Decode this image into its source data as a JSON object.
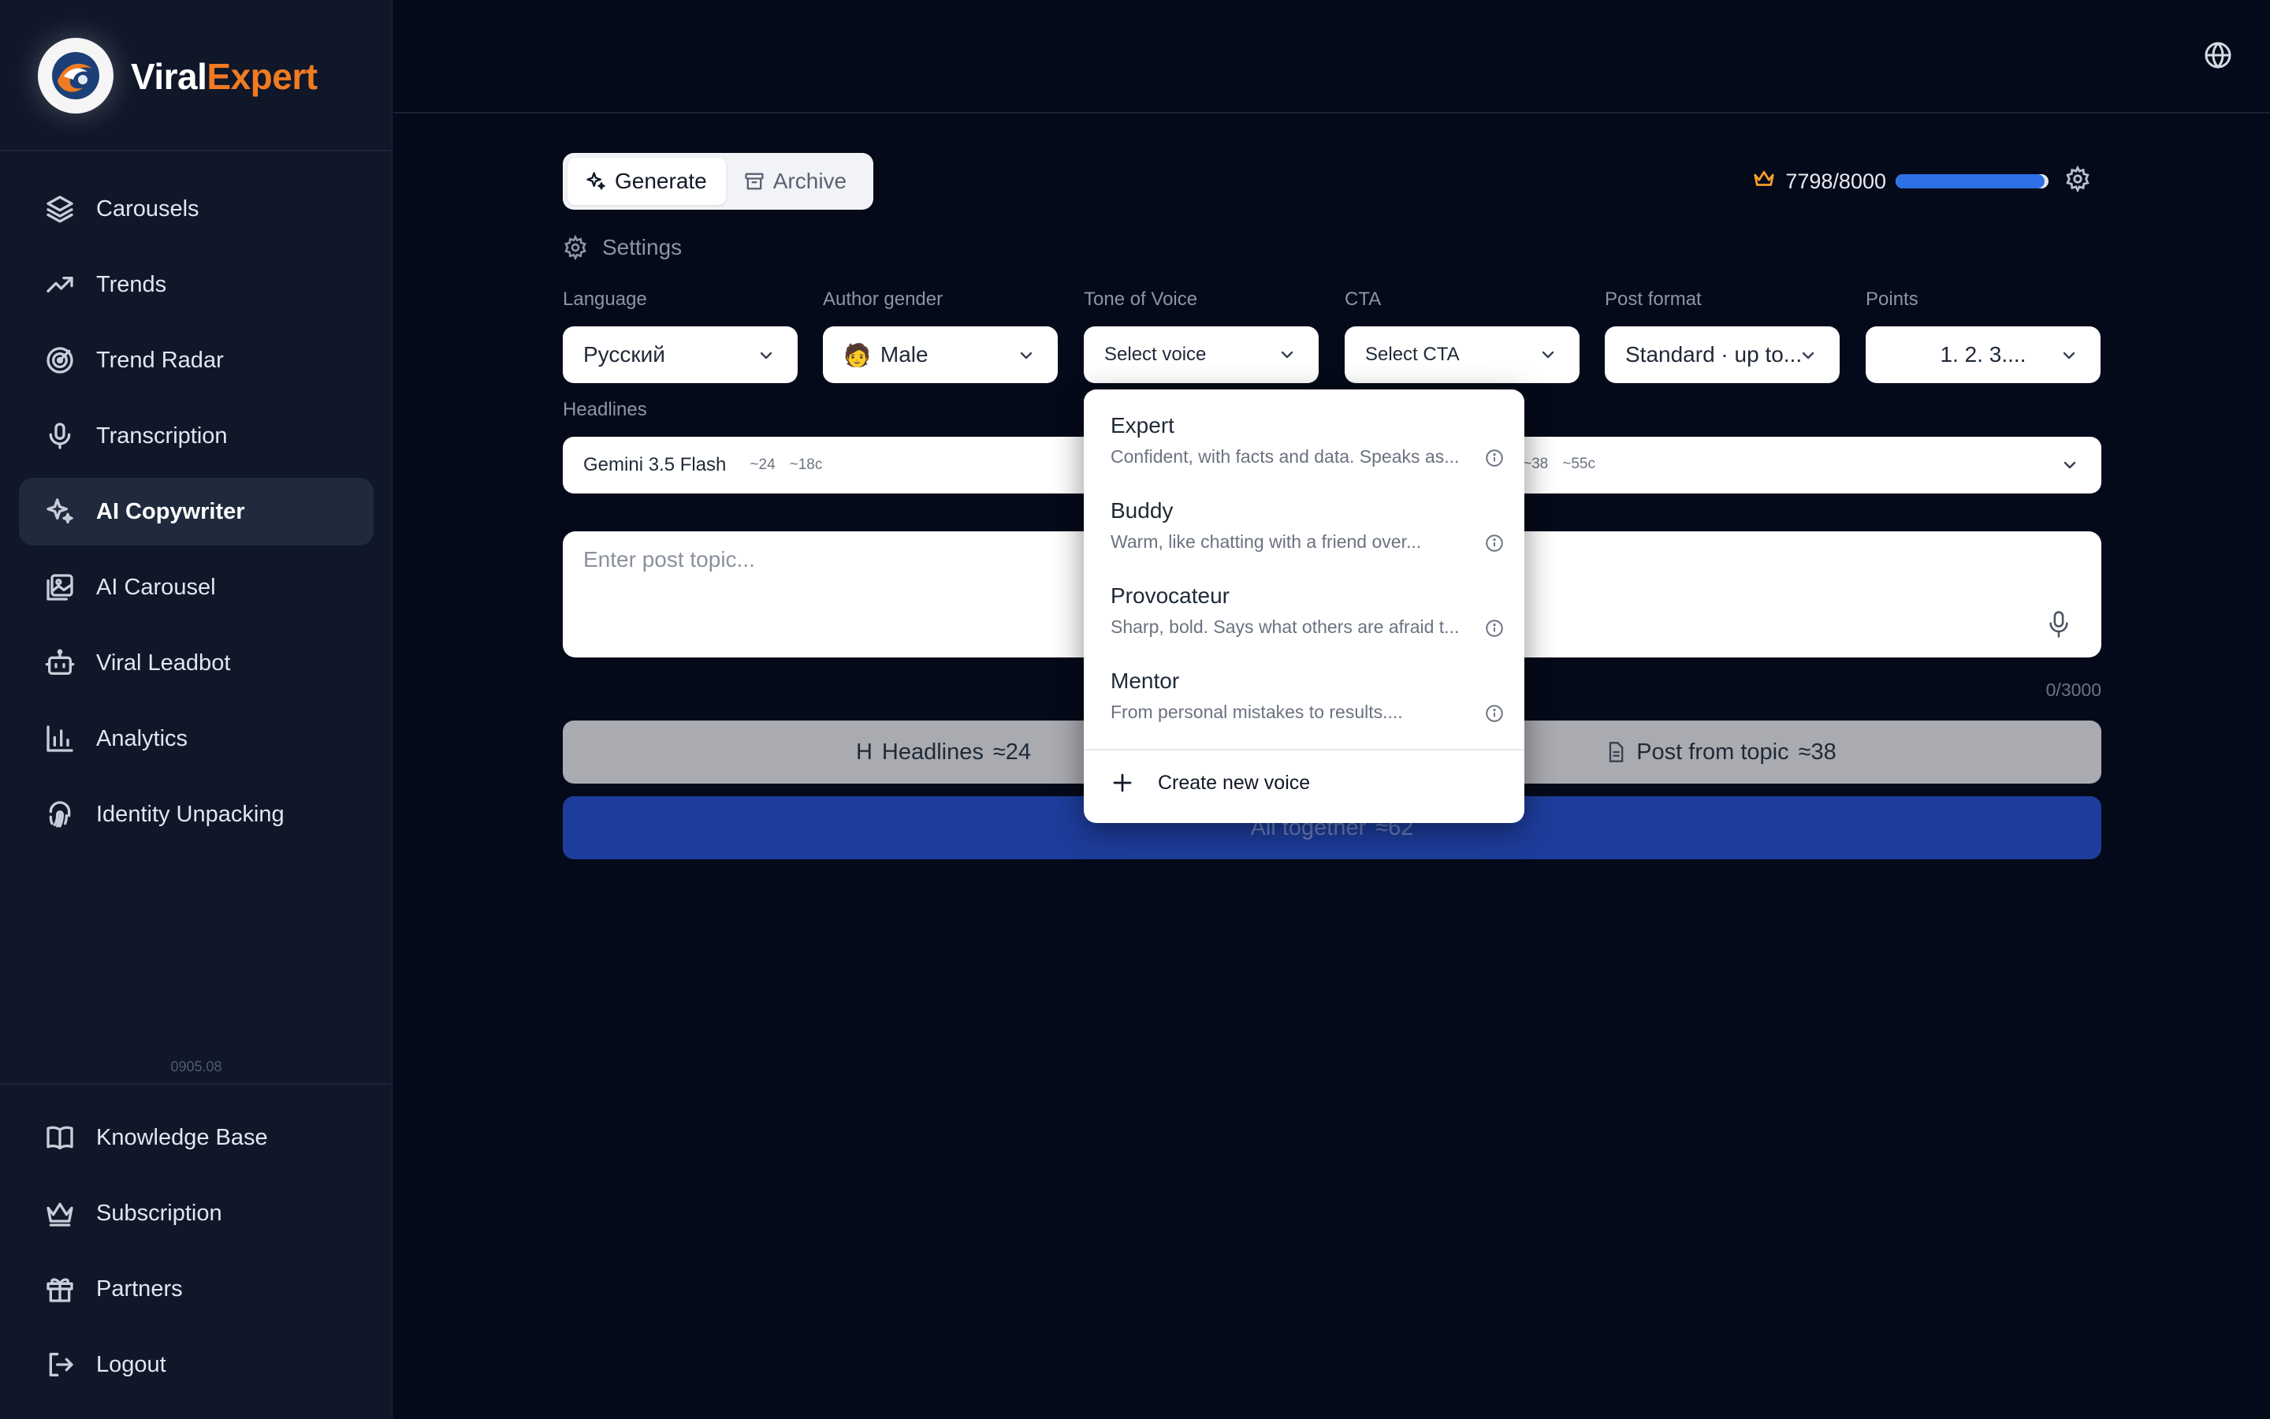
{
  "brand": {
    "name_part1": "Viral",
    "name_part2": "Expert",
    "accent": "#f07b22"
  },
  "sidebar": {
    "items": [
      {
        "label": "Carousels",
        "icon": "layers-icon"
      },
      {
        "label": "Trends",
        "icon": "trending-up-icon"
      },
      {
        "label": "Trend Radar",
        "icon": "radar-icon"
      },
      {
        "label": "Transcription",
        "icon": "mic-icon"
      },
      {
        "label": "AI Copywriter",
        "icon": "sparkles-icon",
        "active": true
      },
      {
        "label": "AI Carousel",
        "icon": "images-icon"
      },
      {
        "label": "Viral Leadbot",
        "icon": "bot-icon"
      },
      {
        "label": "Analytics",
        "icon": "bar-chart-icon"
      },
      {
        "label": "Identity Unpacking",
        "icon": "fingerprint-icon"
      }
    ],
    "version": "0905.08",
    "bottom_items": [
      {
        "label": "Knowledge Base",
        "icon": "book-icon"
      },
      {
        "label": "Subscription",
        "icon": "crown-icon"
      },
      {
        "label": "Partners",
        "icon": "gift-icon"
      },
      {
        "label": "Logout",
        "icon": "logout-icon"
      }
    ]
  },
  "tabs": {
    "generate": "Generate",
    "archive": "Archive"
  },
  "quota": {
    "text": "7798/8000",
    "used": 7798,
    "total": 8000,
    "bar_color": "#2f6fe8"
  },
  "settings": {
    "label": "Settings"
  },
  "fields": {
    "language": {
      "label": "Language",
      "value": "Русский"
    },
    "gender": {
      "label": "Author gender",
      "emoji": "🧑",
      "value": "Male"
    },
    "tone": {
      "label": "Tone of Voice",
      "value": "Select voice"
    },
    "cta": {
      "label": "CTA",
      "value": "Select CTA"
    },
    "format": {
      "label": "Post format",
      "value": "Standard · up to..."
    },
    "points": {
      "label": "Points",
      "value": "1. 2. 3...."
    }
  },
  "headlines": {
    "label": "Headlines",
    "model": "Gemini 3.5 Flash",
    "meta_left": [
      "~24",
      "~18c"
    ],
    "meta_right": [
      "~38",
      "~55c"
    ]
  },
  "topic": {
    "placeholder": "Enter post topic...",
    "counter": "0/3000"
  },
  "buttons": {
    "headlines": "Headlines",
    "headlines_cost": "≈24",
    "post": "Post from topic",
    "post_cost": "≈38",
    "all": "All together",
    "all_cost": "≈62"
  },
  "dropdown": {
    "options": [
      {
        "title": "Expert",
        "desc": "Confident, with facts and data. Speaks as..."
      },
      {
        "title": "Buddy",
        "desc": "Warm, like chatting with a friend over..."
      },
      {
        "title": "Provocateur",
        "desc": "Sharp, bold. Says what others are afraid t..."
      },
      {
        "title": "Mentor",
        "desc": "From personal mistakes to results...."
      }
    ],
    "create": "Create new voice"
  }
}
